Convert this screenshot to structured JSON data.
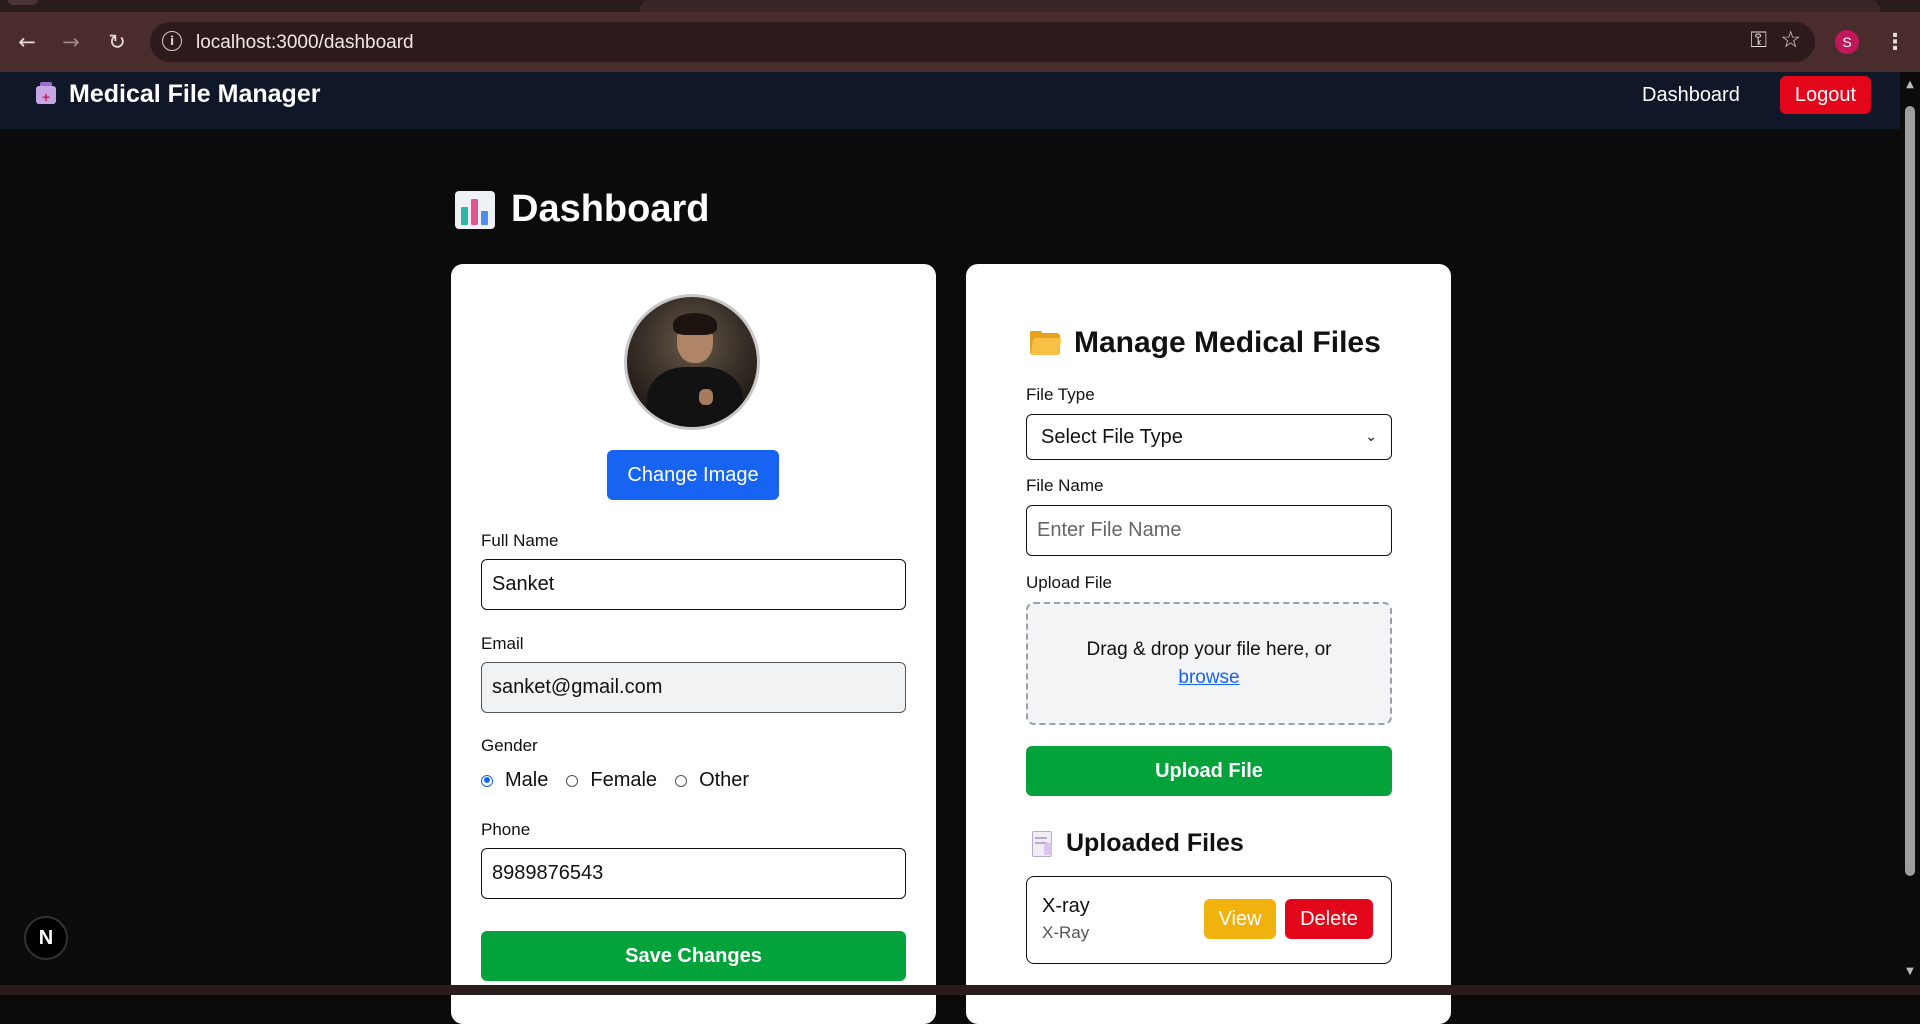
{
  "browser": {
    "url": "localhost:3000/dashboard",
    "profile_initial": "S",
    "icons": {
      "back": "arrow-left-icon",
      "forward": "arrow-right-icon",
      "reload": "reload-icon",
      "site_info": "info-icon",
      "password": "key-icon",
      "bookmark": "star-icon",
      "menu": "kebab-menu-icon"
    }
  },
  "navbar": {
    "brand": "Medical File Manager",
    "dashboard_link": "Dashboard",
    "logout_label": "Logout"
  },
  "page": {
    "title": "Dashboard"
  },
  "profile": {
    "change_image_label": "Change Image",
    "full_name_label": "Full Name",
    "full_name_value": "Sanket",
    "email_label": "Email",
    "email_value": "sanket@gmail.com",
    "gender_label": "Gender",
    "gender_options": [
      "Male",
      "Female",
      "Other"
    ],
    "gender_selected": "Male",
    "phone_label": "Phone",
    "phone_value": "8989876543",
    "save_label": "Save Changes"
  },
  "files": {
    "title": "Manage Medical Files",
    "file_type_label": "File Type",
    "file_type_selected": "Select File Type",
    "file_name_label": "File Name",
    "file_name_placeholder": "Enter File Name",
    "upload_file_label": "Upload File",
    "dropzone_text": "Drag & drop your file here, or",
    "browse_label": "browse",
    "upload_button_label": "Upload File",
    "uploaded_title": "Uploaded Files",
    "uploaded": [
      {
        "name": "X-ray",
        "type": "X-Ray",
        "view_label": "View",
        "delete_label": "Delete"
      }
    ]
  },
  "dev": {
    "indicator": "N"
  },
  "colors": {
    "primary_blue": "#1763f2",
    "success_green": "#04a23b",
    "danger_red": "#e3061a",
    "warning_yellow": "#f1b20d",
    "navbar_bg": "#0f1729",
    "page_bg": "#0b0b0b"
  }
}
